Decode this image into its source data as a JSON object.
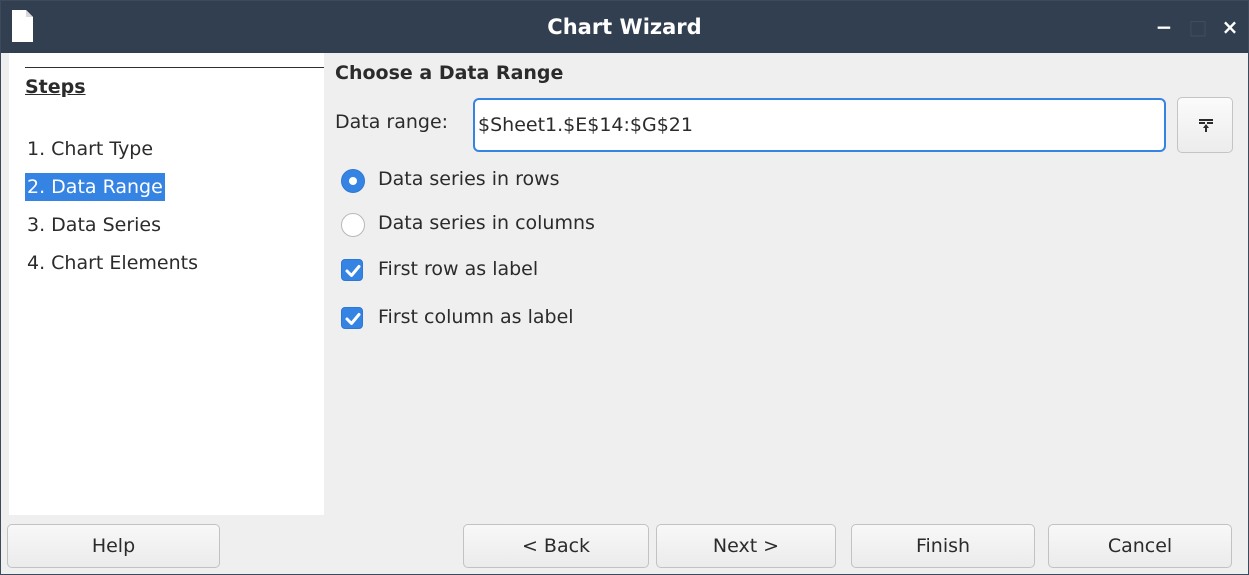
{
  "window": {
    "title": "Chart Wizard",
    "minimize_glyph": "−",
    "maximize_glyph": "□",
    "close_glyph": "×",
    "app_icon": "document-icon"
  },
  "steps": {
    "title": "Steps",
    "items": [
      {
        "label": "1. Chart Type",
        "active": false
      },
      {
        "label": "2. Data Range",
        "active": true
      },
      {
        "label": "3. Data Series",
        "active": false
      },
      {
        "label": "4. Chart Elements",
        "active": false
      }
    ]
  },
  "main": {
    "section_title": "Choose a Data Range",
    "data_range_label": "Data range:",
    "data_range_value": "$Sheet1.$E$14:$G$21",
    "shrink_button_icon": "shrink-dialog-icon",
    "options": {
      "rows": {
        "label": "Data series in rows",
        "checked": true
      },
      "columns": {
        "label": "Data series in columns",
        "checked": false
      },
      "first_row": {
        "label": "First row as label",
        "checked": true
      },
      "first_column": {
        "label": "First column as label",
        "checked": true
      }
    }
  },
  "footer": {
    "help": "Help",
    "back": "< Back",
    "next": "Next >",
    "finish": "Finish",
    "cancel": "Cancel"
  },
  "colors": {
    "titlebar": "#323f51",
    "accent": "#3584e4",
    "panel_bg": "#efefef"
  }
}
